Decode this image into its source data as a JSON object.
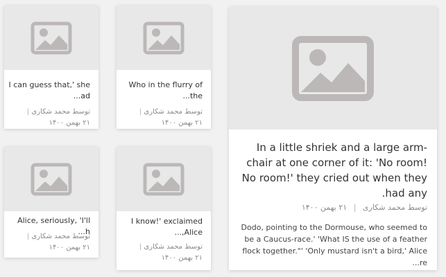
{
  "small_cards": [
    {
      "title": "I can guess that,' she ad...",
      "author": "توسط محمد شکاری",
      "date": "۲۱ بهمن ۱۴۰۰"
    },
    {
      "title": "Who in the flurry of the...",
      "author": "توسط محمد شکاری",
      "date": "۲۱ بهمن ۱۴۰۰"
    },
    {
      "title": "Alice, seriously, 'I'll h...",
      "author": "توسط محمد شکاری",
      "date": "۲۱ بهمن ۱۴۰۰"
    },
    {
      "title": "I know!' exclaimed Alice,...",
      "author": "توسط محمد شکاری",
      "date": "۲۱ بهمن ۱۴۰۰"
    }
  ],
  "featured_card": {
    "title": "In a little shriek and a large arm-chair at one corner of it: 'No room! No room!' they cried out when they had any.",
    "author": "توسط محمد شکاری",
    "date": "۲۱ بهمن ۱۴۰۰",
    "excerpt": "Dodo, pointing to the Dormouse, who seemed to be a Caucus-race.' 'What IS the use of a feather flock together.\"' 'Only mustard isn't a bird,' Alice re..."
  },
  "colors": {
    "background": "#f1f1f1",
    "placeholder_bg": "#e8e8e8",
    "placeholder_icon": "#bcb8b8"
  },
  "icons": {
    "placeholder": "image-placeholder-icon"
  }
}
